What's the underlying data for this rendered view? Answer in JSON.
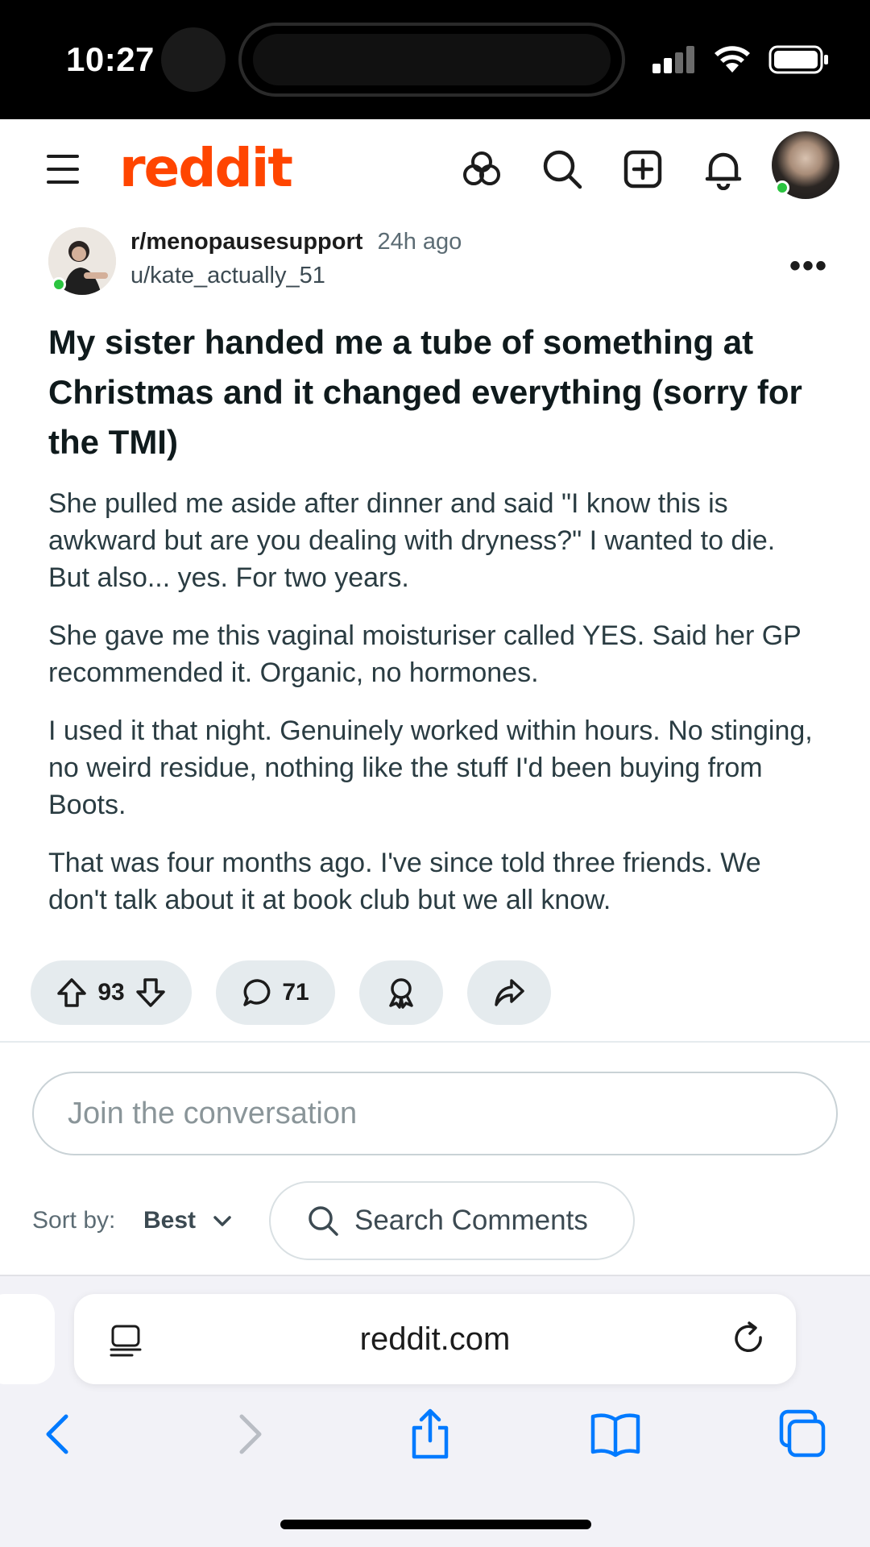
{
  "status_bar": {
    "time": "10:27"
  },
  "header": {
    "logo_text": "reddit",
    "brand_color": "#ff4500",
    "icons": [
      "menu-icon",
      "communities-icon",
      "search-icon",
      "create-post-icon",
      "notifications-icon",
      "user-avatar"
    ]
  },
  "post": {
    "subreddit": "r/menopausesupport",
    "time_ago": "24h ago",
    "author": "u/kate_actually_51",
    "more_label": "•••",
    "title": "My sister handed me a tube of something at Christmas and it changed everything (sorry for the TMI)",
    "paragraphs": [
      "She pulled me aside after dinner and said \"I know this is awkward but are you dealing with dryness?\" I wanted to die. But also... yes. For two years.",
      "She gave me this vaginal moisturiser called YES. Said her GP recommended it. Organic, no hormones.",
      "I used it that night. Genuinely worked within hours. No stinging, no weird residue, nothing like the stuff I'd been buying from Boots.",
      "That was four months ago. I've since told three friends. We don't talk about it at book club but we all know."
    ],
    "upvotes": "93",
    "comments": "71"
  },
  "comments_section": {
    "input_placeholder": "Join the conversation",
    "sort_label": "Sort by:",
    "sort_value": "Best",
    "search_placeholder": "Search Comments"
  },
  "browser": {
    "url": "reddit.com",
    "toolbar_icons": [
      "back-icon",
      "forward-icon",
      "share-icon",
      "bookmarks-icon",
      "tabs-icon"
    ],
    "accent": "#007aff"
  }
}
